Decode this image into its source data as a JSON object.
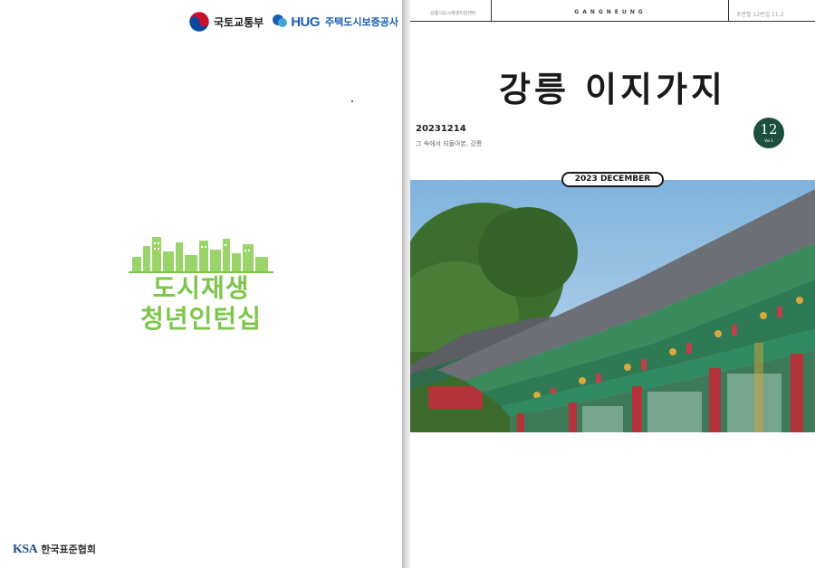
{
  "left_page": {
    "logo_molit": "국토교통부",
    "logo_hug": "HUG",
    "logo_hug_sub": "주택도시보증공사",
    "program_line1": "도시재생",
    "program_line2": "청년인턴십",
    "publisher_mark": "KSA",
    "publisher_name": "한국표준협회"
  },
  "right_page": {
    "header_left": "강릉시도시재생지원센터",
    "header_center": "GANGNEUNG",
    "header_right": "주관철 12번길 11-2",
    "title": "강릉 이지가지",
    "issue_date": "20231214",
    "issue_subtitle": "그 속에서 되돌아본, 강릉",
    "volume_number": "12",
    "volume_label": "Vol.1",
    "month_label": "2023 DECEMBER"
  },
  "colors": {
    "program_green": "#7cc64a",
    "badge_green": "#1d4f3e",
    "hug_blue": "#1a5fb0"
  }
}
